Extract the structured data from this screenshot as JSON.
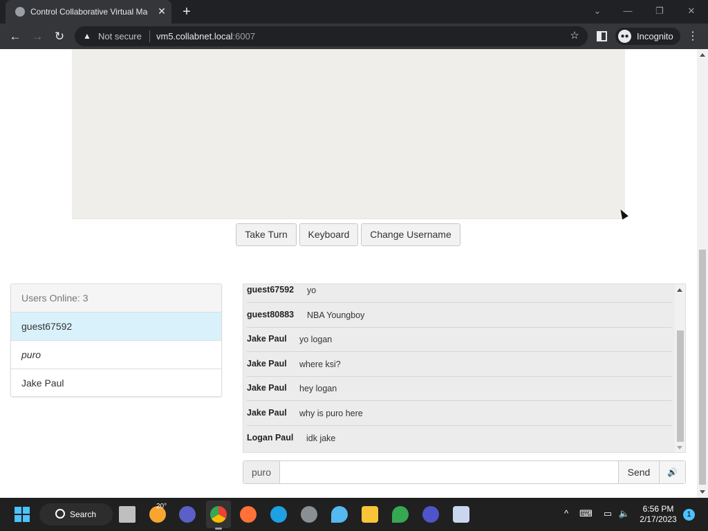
{
  "browser": {
    "tab_title": "Control Collaborative Virtual Machine",
    "tab_close": "✕",
    "new_tab": "+",
    "security_label": "Not secure",
    "url_host": "vm5.collabnet.local",
    "url_port": ":6007",
    "profile_label": "Incognito"
  },
  "controls": {
    "take_turn": "Take Turn",
    "keyboard": "Keyboard",
    "change_username": "Change Username"
  },
  "users": {
    "header": "Users Online: 3",
    "list": [
      {
        "name": "guest67592"
      },
      {
        "name": "puro"
      },
      {
        "name": "Jake Paul"
      }
    ]
  },
  "chat": {
    "messages": [
      {
        "user": "guest67592",
        "text": "yo"
      },
      {
        "user": "guest80883",
        "text": "NBA Youngboy"
      },
      {
        "user": "Jake Paul",
        "text": "yo logan"
      },
      {
        "user": "Jake Paul",
        "text": "where ksi?"
      },
      {
        "user": "Jake Paul",
        "text": "hey logan"
      },
      {
        "user": "Jake Paul",
        "text": "why is puro here"
      },
      {
        "user": "Logan Paul",
        "text": "idk jake"
      }
    ],
    "current_username": "puro",
    "input_value": "",
    "send_label": "Send"
  },
  "taskbar": {
    "search_label": "Search",
    "weather_temp": "20°",
    "time": "6:56 PM",
    "date": "2/17/2023",
    "notification_count": "1"
  }
}
